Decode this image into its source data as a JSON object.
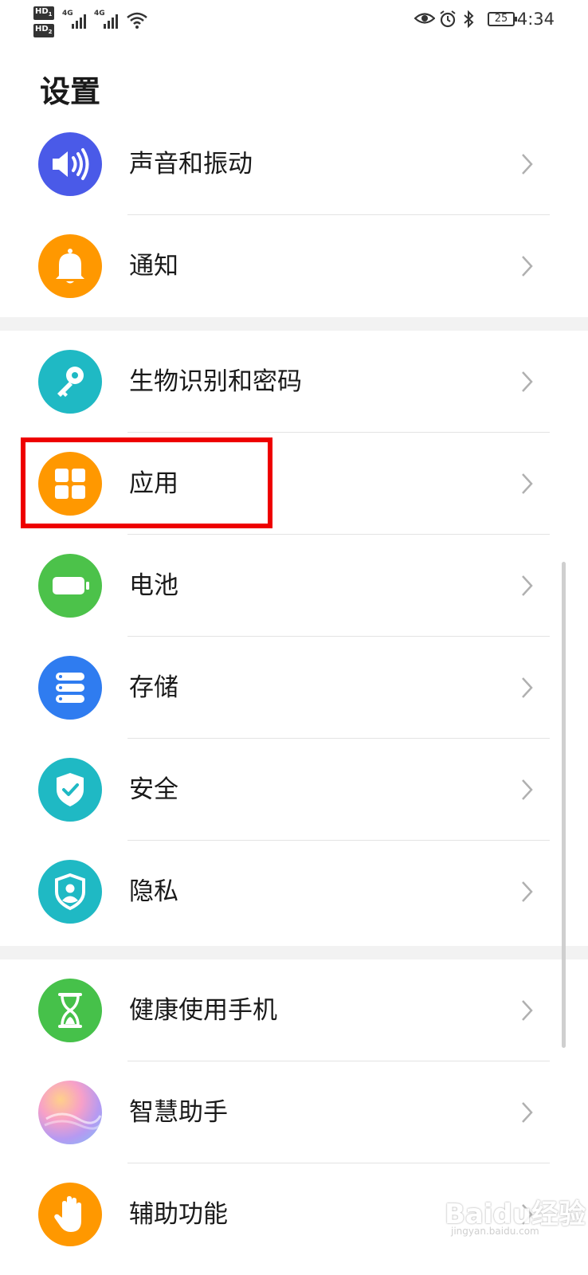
{
  "status_bar": {
    "sim1": "HD",
    "sim1_index": "1",
    "sim2": "HD",
    "sim2_index": "2",
    "network1": "4G",
    "network2": "4G",
    "battery": "25",
    "time": "4:34",
    "icons": [
      "eye-icon",
      "alarm-icon",
      "bluetooth-icon",
      "wifi-icon"
    ]
  },
  "page": {
    "title": "设置"
  },
  "groups": [
    {
      "items": [
        {
          "label": "声音和振动",
          "icon": "speaker-icon",
          "color": "#4a5ae8"
        },
        {
          "label": "通知",
          "icon": "bell-icon",
          "color": "#ff9800"
        }
      ]
    },
    {
      "items": [
        {
          "label": "生物识别和密码",
          "icon": "key-icon",
          "color": "#1fb9c4"
        },
        {
          "label": "应用",
          "icon": "apps-grid-icon",
          "color": "#ff9800"
        },
        {
          "label": "电池",
          "icon": "battery-icon",
          "color": "#4cc24a"
        },
        {
          "label": "存储",
          "icon": "storage-icon",
          "color": "#2f7cf0"
        },
        {
          "label": "安全",
          "icon": "shield-check-icon",
          "color": "#1fb9c4"
        },
        {
          "label": "隐私",
          "icon": "privacy-shield-icon",
          "color": "#1fb9c4"
        }
      ]
    },
    {
      "items": [
        {
          "label": "健康使用手机",
          "icon": "hourglass-icon",
          "color": "#46c14a"
        },
        {
          "label": "智慧助手",
          "icon": "assistant-orb-icon",
          "color": "#c9a6f0"
        },
        {
          "label": "辅助功能",
          "icon": "hand-icon",
          "color": "#ff9800"
        }
      ]
    }
  ],
  "watermark": {
    "text": "Baidu经验",
    "sub": "jingyan.baidu.com"
  }
}
